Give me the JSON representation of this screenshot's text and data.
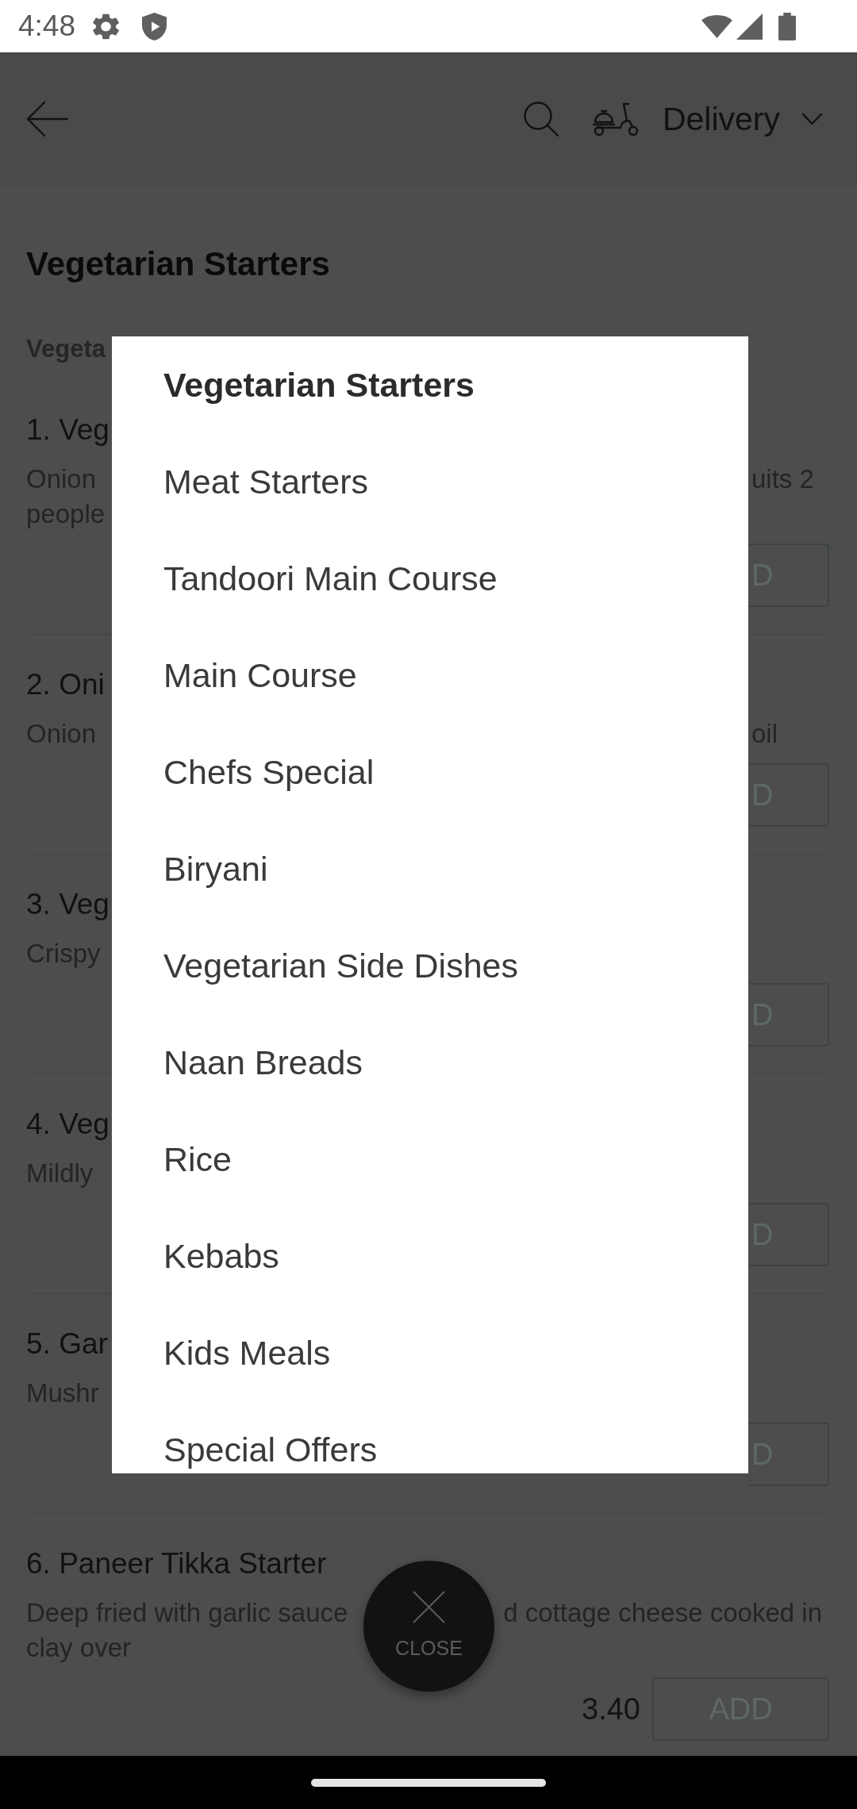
{
  "status_bar": {
    "time": "4:48"
  },
  "app_bar": {
    "order_mode": "Delivery"
  },
  "menu": {
    "heading": "Vegetarian Starters",
    "section": "Vegeta",
    "items": [
      {
        "kind": "covered",
        "title": "1. Veg",
        "description": [
          {
            "left": "Onion",
            "right": "uits 2"
          },
          {
            "left": "people"
          }
        ],
        "button": "D"
      },
      {
        "kind": "covered",
        "title": "2. Oni",
        "description": [
          {
            "left": "Onion",
            "right": "oil"
          }
        ],
        "button": "D"
      },
      {
        "kind": "covered",
        "title": "3. Veg",
        "description": [
          {
            "left": "Crispy"
          }
        ],
        "button": "D"
      },
      {
        "kind": "covered",
        "title": "4. Veg",
        "description": [
          {
            "left": "Mildly"
          }
        ],
        "button": "D"
      },
      {
        "kind": "covered",
        "title": "5. Gar",
        "description": [
          {
            "left": "Mushr"
          }
        ],
        "button": "D"
      },
      {
        "kind": "open",
        "title": "6. Paneer Tikka Starter",
        "description": [
          {
            "left": "Deep fried with garlic sauce",
            "right": "d cottage cheese cooked in"
          },
          {
            "left": "clay over"
          }
        ],
        "price": "3.40",
        "button": "ADD"
      }
    ]
  },
  "category_dialog": {
    "categories": [
      {
        "label": "Vegetarian Starters",
        "selected": true
      },
      {
        "label": "Meat Starters",
        "selected": false
      },
      {
        "label": "Tandoori Main Course",
        "selected": false
      },
      {
        "label": "Main Course",
        "selected": false
      },
      {
        "label": "Chefs Special",
        "selected": false
      },
      {
        "label": "Biryani",
        "selected": false
      },
      {
        "label": "Vegetarian Side Dishes",
        "selected": false
      },
      {
        "label": "Naan Breads",
        "selected": false
      },
      {
        "label": "Rice",
        "selected": false
      },
      {
        "label": "Kebabs",
        "selected": false
      },
      {
        "label": "Kids Meals",
        "selected": false
      },
      {
        "label": "Special Offers",
        "selected": false
      }
    ]
  },
  "close_button": {
    "label": "CLOSE"
  }
}
